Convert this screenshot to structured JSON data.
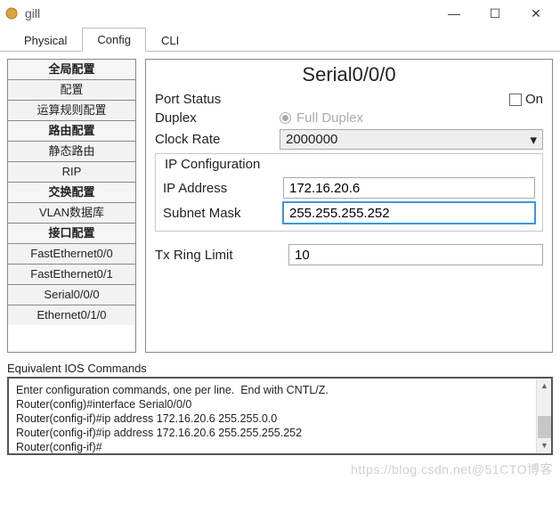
{
  "window": {
    "title": "gill",
    "buttons": {
      "min": "—",
      "max": "☐",
      "close": "✕"
    }
  },
  "tabs": [
    {
      "label": "Physical",
      "active": false
    },
    {
      "label": "Config",
      "active": true
    },
    {
      "label": "CLI",
      "active": false
    }
  ],
  "sidebar": [
    {
      "label": "全局配置",
      "head": true
    },
    {
      "label": "配置"
    },
    {
      "label": "运算规则配置"
    },
    {
      "label": "路由配置",
      "head": true
    },
    {
      "label": "静态路由"
    },
    {
      "label": "RIP"
    },
    {
      "label": "交换配置",
      "head": true
    },
    {
      "label": "VLAN数据库"
    },
    {
      "label": "接口配置",
      "head": true
    },
    {
      "label": "FastEthernet0/0"
    },
    {
      "label": "FastEthernet0/1"
    },
    {
      "label": "Serial0/0/0"
    },
    {
      "label": "Ethernet0/1/0"
    }
  ],
  "panel": {
    "title": "Serial0/0/0",
    "portStatusLabel": "Port Status",
    "onLabel": "On",
    "duplexLabel": "Duplex",
    "duplexOption": "Full Duplex",
    "clockRateLabel": "Clock Rate",
    "clockRateValue": "2000000",
    "ipConfigLegend": "IP Configuration",
    "ipAddrLabel": "IP Address",
    "ipAddrValue": "172.16.20.6",
    "maskLabel": "Subnet Mask",
    "maskValue": "255.255.255.252",
    "txLabel": "Tx Ring Limit",
    "txValue": "10"
  },
  "commands": {
    "title": "Equivalent IOS Commands",
    "text": "Enter configuration commands, one per line.  End with CNTL/Z.\nRouter(config)#interface Serial0/0/0\nRouter(config-if)#ip address 172.16.20.6 255.255.0.0\nRouter(config-if)#ip address 172.16.20.6 255.255.255.252\nRouter(config-if)#"
  },
  "watermark": "https://blog.csdn.net@51CTO博客"
}
